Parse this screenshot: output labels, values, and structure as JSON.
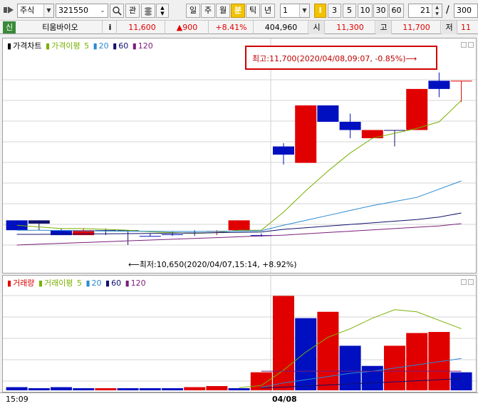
{
  "toolbar": {
    "market_select": "주식",
    "stock_code": "321550",
    "watch_label": "관",
    "period_buttons": [
      "일",
      "주",
      "월",
      "분",
      "틱",
      "년"
    ],
    "active_period": "분",
    "interval_value": "1",
    "minute_buttons": [
      "I",
      "3",
      "5",
      "10",
      "30",
      "60"
    ],
    "active_minute": "I",
    "count_value": "21",
    "separator": "/",
    "total_value": "300"
  },
  "quote": {
    "badge": "신",
    "name": "티움바이오",
    "info_label": "i",
    "price": "11,600",
    "change": "▲900",
    "change_pct": "+8.41%",
    "volume": "404,960",
    "open_label": "시",
    "open": "11,300",
    "high_label": "고",
    "high": "11,700",
    "low_label": "저",
    "low": "11"
  },
  "colors": {
    "up": "#e00000",
    "down": "#0010c0",
    "ma5": "#7ab000",
    "ma20": "#2a8ad0",
    "ma60": "#10106e",
    "ma120": "#7a1e7a",
    "annotation_box": "#d00000"
  },
  "price_panel": {
    "title": "가격차트",
    "legend": [
      {
        "label": "가격이평",
        "color": "#7ab000"
      },
      {
        "label": "5",
        "color": "#7ab000"
      },
      {
        "label": "20",
        "color": "#2a8ad0"
      },
      {
        "label": "60",
        "color": "#10106e"
      },
      {
        "label": "120",
        "color": "#7a1e7a"
      }
    ],
    "high_annotation": "최고:11,700(2020/04/08,09:07, -0.85%)⟶",
    "low_annotation": "⟵최저:10,650(2020/04/07,15:14, +8.92%)"
  },
  "volume_panel": {
    "title": "거래량",
    "legend": [
      {
        "label": "거래이평",
        "color": "#7ab000"
      },
      {
        "label": "5",
        "color": "#7ab000"
      },
      {
        "label": "20",
        "color": "#2a8ad0"
      },
      {
        "label": "60",
        "color": "#10106e"
      },
      {
        "label": "120",
        "color": "#7a1e7a"
      }
    ]
  },
  "x_axis": {
    "left_label": "15:09",
    "date_label": "04/08"
  },
  "chart_data": {
    "type": "candlestick",
    "ylim": [
      10550,
      11760
    ],
    "candles": [
      {
        "o": 10800,
        "h": 10800,
        "l": 10740,
        "c": 10740,
        "dir": "down"
      },
      {
        "o": 10800,
        "h": 10800,
        "l": 10740,
        "c": 10780,
        "dir": "flat"
      },
      {
        "o": 10740,
        "h": 10750,
        "l": 10710,
        "c": 10710,
        "dir": "down"
      },
      {
        "o": 10710,
        "h": 10750,
        "l": 10710,
        "c": 10740,
        "dir": "up"
      },
      {
        "o": 10740,
        "h": 10750,
        "l": 10710,
        "c": 10740,
        "dir": "flat"
      },
      {
        "o": 10740,
        "h": 10740,
        "l": 10650,
        "c": 10740,
        "dir": "flat"
      },
      {
        "o": 10705,
        "h": 10720,
        "l": 10705,
        "c": 10705,
        "dir": "down"
      },
      {
        "o": 10715,
        "h": 10730,
        "l": 10705,
        "c": 10715,
        "dir": "down"
      },
      {
        "o": 10725,
        "h": 10740,
        "l": 10705,
        "c": 10725,
        "dir": "down"
      },
      {
        "o": 10735,
        "h": 10740,
        "l": 10710,
        "c": 10735,
        "dir": "up"
      },
      {
        "o": 10740,
        "h": 10800,
        "l": 10740,
        "c": 10800,
        "dir": "up"
      },
      {
        "o": 10710,
        "h": 10720,
        "l": 10700,
        "c": 10710,
        "dir": "down"
      },
      {
        "o": 11250,
        "h": 11270,
        "l": 11140,
        "c": 11200,
        "dir": "down"
      },
      {
        "o": 11150,
        "h": 11500,
        "l": 11150,
        "c": 11500,
        "dir": "up"
      },
      {
        "o": 11500,
        "h": 11500,
        "l": 11400,
        "c": 11400,
        "dir": "down"
      },
      {
        "o": 11400,
        "h": 11450,
        "l": 11300,
        "c": 11350,
        "dir": "down"
      },
      {
        "o": 11350,
        "h": 11350,
        "l": 11300,
        "c": 11300,
        "dir": "up"
      },
      {
        "o": 11350,
        "h": 11350,
        "l": 11250,
        "c": 11350,
        "dir": "flat"
      },
      {
        "o": 11350,
        "h": 11600,
        "l": 11350,
        "c": 11600,
        "dir": "up"
      },
      {
        "o": 11650,
        "h": 11700,
        "l": 11550,
        "c": 11600,
        "dir": "down"
      },
      {
        "o": 11650,
        "h": 11650,
        "l": 11520,
        "c": 11650,
        "dir": "up"
      }
    ],
    "ma5": [
      10770,
      10760,
      10750,
      10750,
      10745,
      10740,
      10730,
      10725,
      10720,
      10725,
      10740,
      10740,
      10850,
      10980,
      11100,
      11210,
      11300,
      11330,
      11360,
      11400,
      11530
    ],
    "ma20": [
      10740,
      10740,
      10738,
      10736,
      10735,
      10734,
      10733,
      10732,
      10732,
      10733,
      10735,
      10737,
      10770,
      10800,
      10830,
      10860,
      10890,
      10915,
      10940,
      10990,
      11040
    ],
    "ma60": [
      10715,
      10715,
      10716,
      10717,
      10718,
      10719,
      10720,
      10722,
      10723,
      10725,
      10727,
      10729,
      10745,
      10755,
      10765,
      10775,
      10785,
      10795,
      10805,
      10820,
      10845
    ],
    "ma120": [
      10650,
      10655,
      10660,
      10665,
      10670,
      10675,
      10680,
      10685,
      10690,
      10695,
      10700,
      10705,
      10710,
      10718,
      10726,
      10734,
      10742,
      10750,
      10758,
      10766,
      10780
    ],
    "volume": {
      "ylim": [
        0,
        100
      ],
      "values": [
        3,
        2,
        3,
        2,
        2,
        2,
        2,
        2,
        3,
        4,
        2,
        17,
        89,
        68,
        74,
        42,
        23,
        42,
        54,
        55,
        17
      ],
      "dir": [
        "down",
        "down",
        "down",
        "down",
        "up",
        "down",
        "down",
        "down",
        "up",
        "up",
        "down",
        "up",
        "up",
        "down",
        "up",
        "down",
        "down",
        "up",
        "up",
        "up",
        "down"
      ],
      "ma5": [
        null,
        null,
        null,
        null,
        null,
        null,
        null,
        null,
        null,
        null,
        2.5,
        4.5,
        19,
        36,
        50,
        58,
        68,
        76,
        74,
        66,
        58
      ],
      "ma20": [
        null,
        null,
        null,
        null,
        null,
        null,
        null,
        null,
        null,
        null,
        null,
        2.8,
        7,
        10,
        13,
        16,
        18,
        21,
        24,
        27,
        30
      ],
      "ma60": [
        null,
        null,
        null,
        null,
        null,
        null,
        null,
        null,
        null,
        null,
        null,
        2.2,
        3,
        4,
        5,
        6,
        7,
        8,
        9,
        10,
        11
      ],
      "ma120": [
        null,
        null,
        null,
        null,
        null,
        null,
        null,
        null,
        null,
        null,
        null,
        18,
        18,
        18,
        18,
        18,
        18,
        18,
        18,
        18,
        18
      ]
    }
  }
}
